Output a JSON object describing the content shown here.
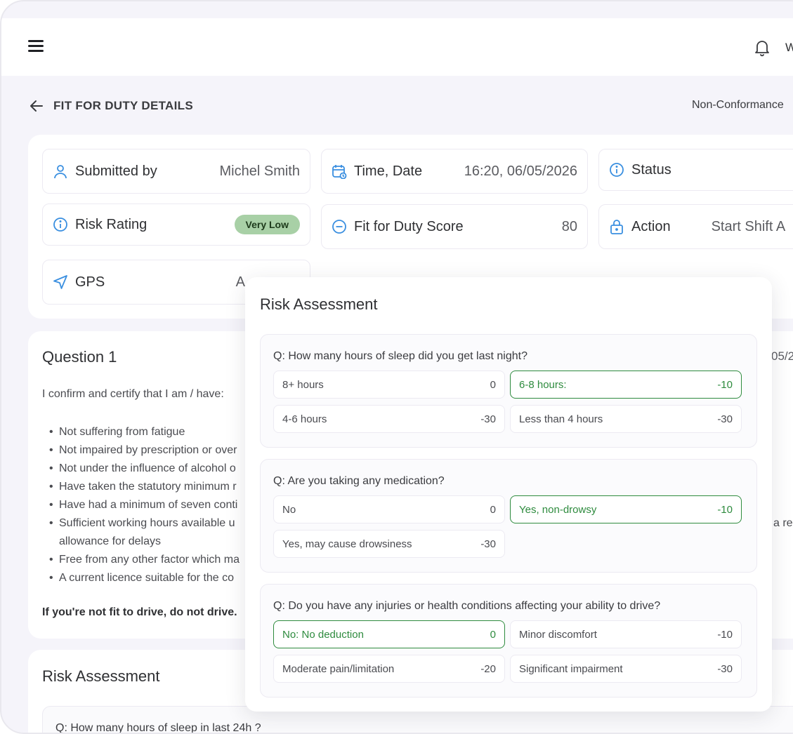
{
  "topbar": {
    "user_fragment": "W"
  },
  "header": {
    "title": "FIT FOR DUTY DETAILS",
    "right_text": "Non-Conformance"
  },
  "info": {
    "submitted_by": {
      "label": "Submitted by",
      "value": "Michel Smith"
    },
    "time_date": {
      "label": "Time, Date",
      "value": "16:20, 06/05/2026"
    },
    "status": {
      "label": "Status"
    },
    "risk_rating": {
      "label": "Risk Rating",
      "badge": "Very Low",
      "badge_color": "#a8d0a6"
    },
    "score": {
      "label": "Fit for Duty Score",
      "value": "80"
    },
    "action": {
      "label": "Action",
      "value": "Start Shift A"
    },
    "gps": {
      "label": "GPS",
      "value": "A"
    }
  },
  "question": {
    "title": "Question 1",
    "date_fragment": "05/2",
    "intro": "I confirm and certify that I am / have:",
    "items": [
      "Not suffering from fatigue",
      "Not impaired by prescription or over",
      "Not under the influence of alcohol o",
      "Have taken the statutory minimum r",
      "Have had a minimum of seven conti",
      "Sufficient working hours available u",
      "allowance for delays",
      "Free from any other factor which ma",
      "A current licence suitable for the co"
    ],
    "right_fragment": "a rea",
    "warning": "If you're not fit to drive, do not drive."
  },
  "risk_section": {
    "title": "Risk Assessment",
    "first_question": "Q: How many hours of sleep in last 24h ?"
  },
  "modal": {
    "title": "Risk Assessment",
    "questions": [
      {
        "text": "Q: How many hours of sleep did you get last night?",
        "options": [
          {
            "label": "8+ hours",
            "points": "0"
          },
          {
            "label": "6-8 hours:",
            "points": "-10"
          },
          {
            "label": "4-6 hours",
            "points": "-30"
          },
          {
            "label": "Less than 4 hours",
            "points": "-30"
          }
        ]
      },
      {
        "text": "Q: Are you taking any medication?",
        "options": [
          {
            "label": "No",
            "points": "0"
          },
          {
            "label": "Yes, non-drowsy",
            "points": "-10"
          },
          {
            "label": "Yes, may cause drowsiness",
            "points": "-30"
          }
        ]
      },
      {
        "text": "Q: Do you have any injuries or health conditions affecting your ability to drive?",
        "options": [
          {
            "label": "No: No deduction",
            "points": "0"
          },
          {
            "label": "Minor discomfort",
            "points": "-10"
          },
          {
            "label": "Moderate pain/limitation",
            "points": "-20"
          },
          {
            "label": "Significant impairment",
            "points": "-30"
          }
        ]
      }
    ]
  },
  "colors": {
    "accent_icon": "#3a8fe0",
    "selected": "#2e8b3e",
    "background": "#f5f4fa"
  },
  "icons": [
    "menu-icon",
    "bell-icon",
    "back-arrow-icon",
    "user-icon",
    "calendar-icon",
    "info-icon",
    "minus-circle-icon",
    "lock-icon",
    "navigation-icon"
  ]
}
